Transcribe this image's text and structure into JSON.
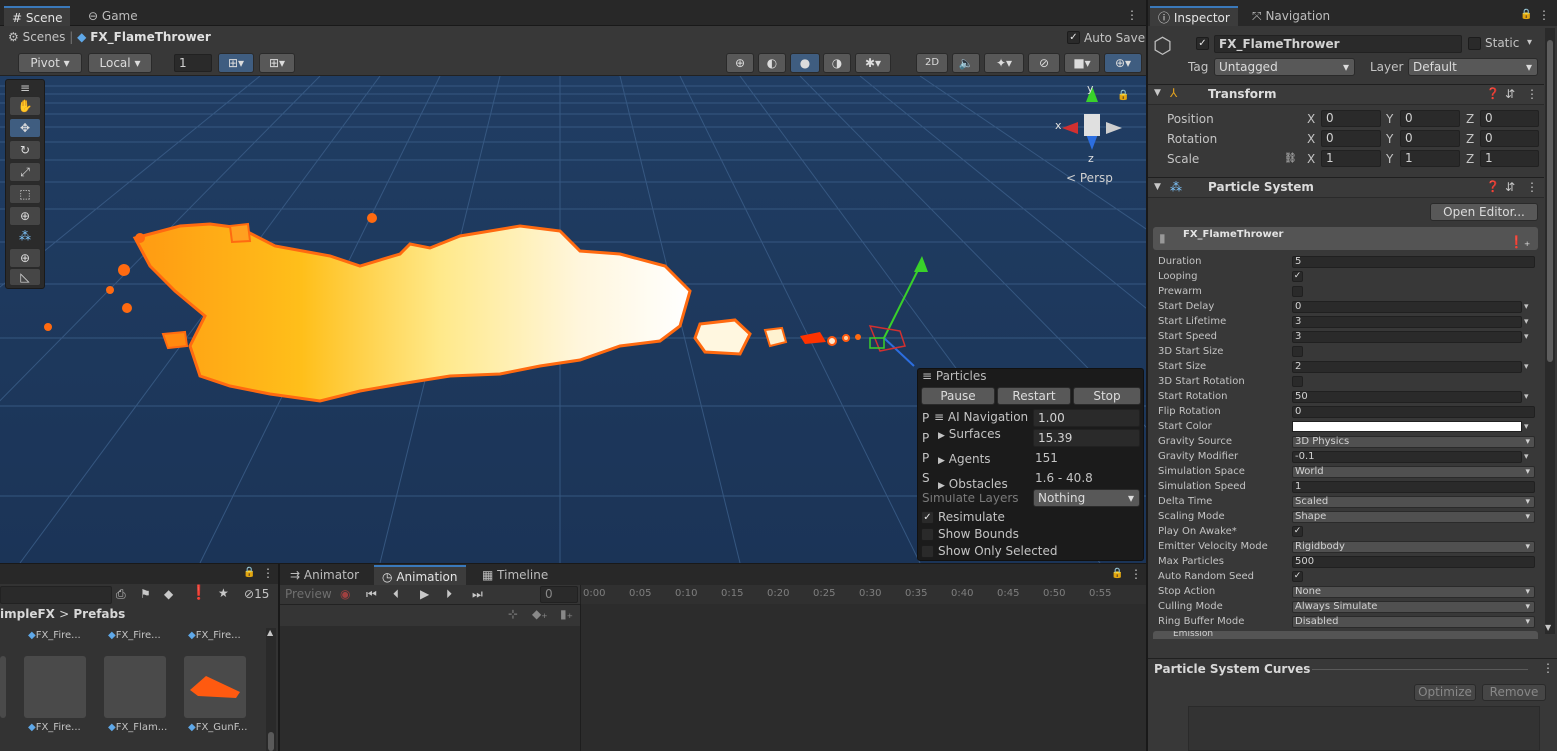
{
  "scene_tabs": {
    "scene": "Scene",
    "game": "Game"
  },
  "breadcrumb": {
    "root": "Scenes",
    "object": "FX_FlameThrower"
  },
  "auto_save": {
    "label": "Auto Save",
    "checked": "✓"
  },
  "toolbar": {
    "pivot": "Pivot",
    "local": "Local",
    "grid_value": "1",
    "mode_2d": "2D"
  },
  "gizmo": {
    "x": "x",
    "y": "y",
    "z": "z",
    "persp": "Persp"
  },
  "particles_overlay": {
    "title": "Particles",
    "pause": "Pause",
    "restart": "Restart",
    "stop": "Stop",
    "row_prefixes": [
      "P",
      "P",
      "P",
      "S",
      "S"
    ],
    "playback_speed": "1.00",
    "playback_time": "15.39",
    "particles": "151",
    "speed_range": "1.6 - 40.8",
    "simulate_layers_label": "Simulate Layers",
    "simulate_layers_value": "Nothing",
    "resimulate": "Resimulate",
    "resimulate_checked": "✓",
    "show_bounds": "Show Bounds",
    "show_only_selected": "Show Only Selected"
  },
  "ai_navigation": {
    "title": "AI Navigation",
    "items": [
      "Surfaces",
      "Agents",
      "Obstacles"
    ]
  },
  "project_panel": {
    "breadcrumb_prefix": "impleFX",
    "breadcrumb_sep": ">",
    "breadcrumb_folder": "Prefabs",
    "hidden_count": "15",
    "top_assets": [
      "FX_Fire...",
      "FX_Fire...",
      "FX_Fire..."
    ],
    "bottom_assets": [
      "FX_Fire...",
      "FX_Flam...",
      "FX_GunF..."
    ]
  },
  "animation_tabs": {
    "animator": "Animator",
    "animation": "Animation",
    "timeline": "Timeline"
  },
  "animation": {
    "preview": "Preview",
    "frame": "0",
    "ruler": [
      "0:00",
      "0:05",
      "0:10",
      "0:15",
      "0:20",
      "0:25",
      "0:30",
      "0:35",
      "0:40",
      "0:45",
      "0:50",
      "0:55"
    ]
  },
  "inspector_tabs": {
    "inspector": "Inspector",
    "navigation": "Navigation"
  },
  "gameobject": {
    "name": "FX_FlameThrower",
    "active_checked": "✓",
    "static": "Static",
    "tag_label": "Tag",
    "tag": "Untagged",
    "layer_label": "Layer",
    "layer": "Default"
  },
  "transform": {
    "title": "Transform",
    "rows": [
      {
        "label": "Position",
        "x": "0",
        "y": "0",
        "z": "0"
      },
      {
        "label": "Rotation",
        "x": "0",
        "y": "0",
        "z": "0"
      },
      {
        "label": "Scale",
        "x": "1",
        "y": "1",
        "z": "1"
      }
    ],
    "axis_x": "X",
    "axis_y": "Y",
    "axis_z": "Z"
  },
  "particle_system": {
    "title": "Particle System",
    "open_editor": "Open Editor...",
    "module_name": "FX_FlameThrower",
    "properties": [
      {
        "label": "Duration",
        "kind": "field",
        "value": "5"
      },
      {
        "label": "Looping",
        "kind": "check",
        "value": "✓"
      },
      {
        "label": "Prewarm",
        "kind": "check",
        "value": ""
      },
      {
        "label": "Start Delay",
        "kind": "field-arrow",
        "value": "0"
      },
      {
        "label": "Start Lifetime",
        "kind": "field-arrow",
        "value": "3"
      },
      {
        "label": "Start Speed",
        "kind": "field-arrow",
        "value": "3"
      },
      {
        "label": "3D Start Size",
        "kind": "check",
        "value": ""
      },
      {
        "label": "Start Size",
        "kind": "field-arrow",
        "value": "2"
      },
      {
        "label": "3D Start Rotation",
        "kind": "check",
        "value": ""
      },
      {
        "label": "Start Rotation",
        "kind": "field-arrow",
        "value": "50"
      },
      {
        "label": "Flip Rotation",
        "kind": "field",
        "value": "0"
      },
      {
        "label": "Start Color",
        "kind": "color",
        "value": "#ffffff"
      },
      {
        "label": "Gravity Source",
        "kind": "drop",
        "value": "3D Physics"
      },
      {
        "label": "Gravity Modifier",
        "kind": "field-arrow",
        "value": "-0.1"
      },
      {
        "label": "Simulation Space",
        "kind": "drop",
        "value": "World"
      },
      {
        "label": "Simulation Speed",
        "kind": "field",
        "value": "1"
      },
      {
        "label": "Delta Time",
        "kind": "drop",
        "value": "Scaled"
      },
      {
        "label": "Scaling Mode",
        "kind": "drop",
        "value": "Shape"
      },
      {
        "label": "Play On Awake*",
        "kind": "check",
        "value": "✓"
      },
      {
        "label": "Emitter Velocity Mode",
        "kind": "drop",
        "value": "Rigidbody"
      },
      {
        "label": "Max Particles",
        "kind": "field",
        "value": "500"
      },
      {
        "label": "Auto Random Seed",
        "kind": "check",
        "value": "✓"
      },
      {
        "label": "Stop Action",
        "kind": "drop",
        "value": "None"
      },
      {
        "label": "Culling Mode",
        "kind": "drop",
        "value": "Always Simulate"
      },
      {
        "label": "Ring Buffer Mode",
        "kind": "drop",
        "value": "Disabled"
      }
    ],
    "emission_partial": "Emission"
  },
  "curves": {
    "title": "Particle System Curves",
    "optimize": "Optimize",
    "remove": "Remove"
  },
  "colors": {
    "accent": "#3a79bb",
    "grid_bg": "#1f3a5c",
    "flame_outer": "#ff6a10",
    "flame_inner": "#fff3c8"
  }
}
